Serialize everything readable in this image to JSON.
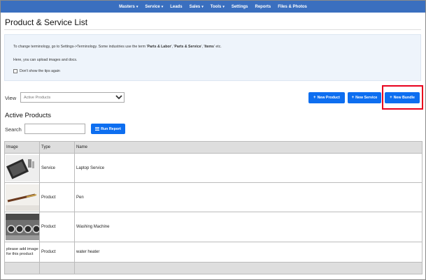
{
  "navbar": {
    "items": [
      {
        "label": "Masters",
        "dropdown": true
      },
      {
        "label": "Service",
        "dropdown": true
      },
      {
        "label": "Leads",
        "dropdown": false
      },
      {
        "label": "Sales",
        "dropdown": true
      },
      {
        "label": "Tools",
        "dropdown": true
      },
      {
        "label": "Settings",
        "dropdown": false
      },
      {
        "label": "Reports",
        "dropdown": false
      },
      {
        "label": "Files & Photos",
        "dropdown": false
      }
    ]
  },
  "page": {
    "title": "Product & Service List"
  },
  "tips": {
    "line1_prefix": "To change terminology, go to Settings->Terminology. Some industries use the term '",
    "term1": "Parts & Labor",
    "sep1": "', '",
    "term2": "Parts & Service",
    "sep2": "', '",
    "term3": "Items",
    "line1_suffix": "' etc.",
    "line2": "Here, you can upload images and docs.",
    "dont_show_label": "Don't show the tips again",
    "dont_show_checked": false
  },
  "view": {
    "label": "View",
    "selected": "Active Products"
  },
  "buttons": {
    "new_product": "New Product",
    "new_service": "New Service",
    "new_bundle": "New Bundle",
    "run_report": "Run Report"
  },
  "section": {
    "title": "Active Products"
  },
  "search": {
    "label": "Search",
    "value": ""
  },
  "table": {
    "headers": [
      "Image",
      "Type",
      "Name"
    ],
    "rows": [
      {
        "image": "laptop-thumbnail",
        "image_text": "",
        "type": "Service",
        "name": "Laptop Service"
      },
      {
        "image": "pen-thumbnail",
        "image_text": "",
        "type": "Product",
        "name": "Pen"
      },
      {
        "image": "washing-machine-thumbnail",
        "image_text": "",
        "type": "Product",
        "name": "Washing Machine"
      },
      {
        "image": "",
        "image_text": "please add image for this product",
        "type": "Product",
        "name": "water heater"
      }
    ]
  },
  "colors": {
    "navbar": "#3a6fbf",
    "primary_button": "#0d6ef0",
    "highlight": "#e8001c",
    "tips_bg": "#eef4fb"
  }
}
